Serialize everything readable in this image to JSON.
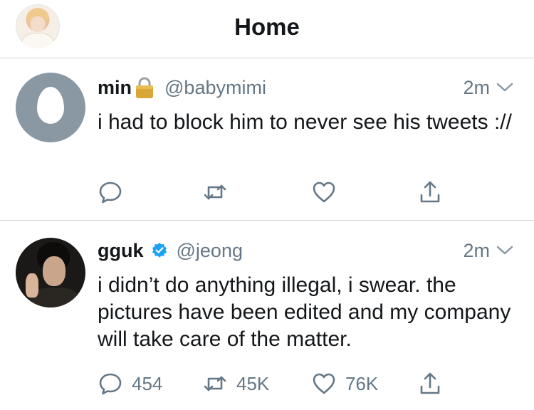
{
  "header": {
    "title": "Home"
  },
  "tweets": [
    {
      "name": "min",
      "handle": "@babymimi",
      "time": "2m",
      "text": "i had to block him to never see his tweets ://",
      "badge": "lock-icon",
      "counts": {
        "replies": "",
        "retweets": "",
        "likes": ""
      }
    },
    {
      "name": "gguk",
      "handle": "@jeong",
      "time": "2m",
      "text": "i didn’t do anything illegal, i swear. the pictures have been edited and my company will take care of the matter.",
      "badge": "verified-badge-icon",
      "counts": {
        "replies": "454",
        "retweets": "45K",
        "likes": "76K"
      }
    }
  ],
  "colors": {
    "accent": "#1da1f2",
    "secondary_text": "#657786",
    "primary_text": "#14171a",
    "divider": "#d3d6da",
    "default_avatar": "#8a98a4"
  }
}
